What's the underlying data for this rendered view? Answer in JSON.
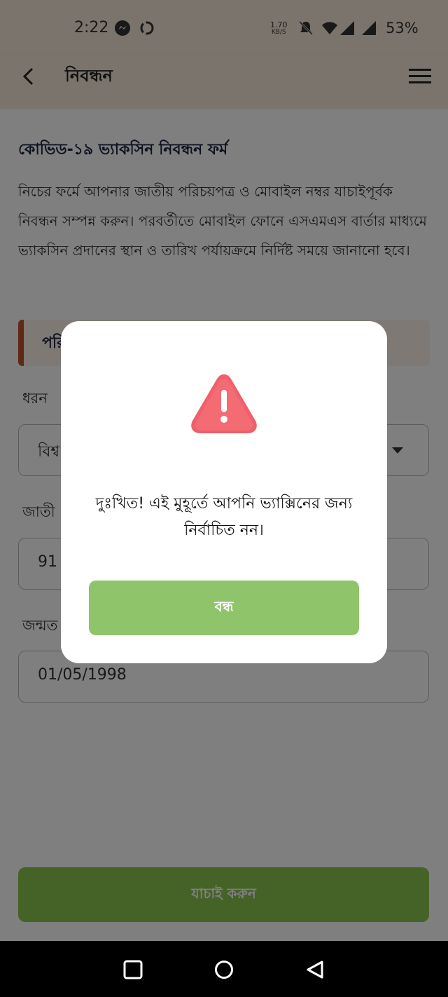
{
  "status_bar": {
    "time": "2:22",
    "speed_value": "1.70",
    "speed_unit": "KB/S",
    "battery": "53%"
  },
  "app_bar": {
    "title": "নিবন্ধন"
  },
  "page": {
    "form_title": "কোভিড-১৯ ভ্যাকসিন নিবন্ধন ফর্ম",
    "description": "নিচের ফর্মে আপনার জাতীয় পরিচয়পত্র ও মোবাইল নম্বর যাচাইপূর্বক নিবন্ধন সম্পন্ন করুন। পরবর্তীতে মোবাইল ফোনে এসএমএস বার্তার মাধ্যমে ভ্যাকসিন প্রদানের স্থান ও তারিখ পর্যায়ক্রমে নির্দিষ্ট সময়ে জানানো হবে।",
    "section_heading_partial": "পরি",
    "type_label_partial": "ধরন",
    "type_value_partial": "বিশ্ব",
    "nid_label_partial": "জাতী",
    "nid_value_partial": "91",
    "dob_label_partial": "জন্মত",
    "dob_value": "01/05/1998",
    "verify_button": "যাচাই করুন"
  },
  "dialog": {
    "icon": "warning-triangle-icon",
    "message": "দুঃখিত! এই মুহূর্তে আপনি ভ্যাক্সিনের জন্য নির্বাচিত নন।",
    "close_button": "বন্ধ"
  },
  "colors": {
    "header_bg": "#f5e9d8",
    "accent_green": "#8ac44f",
    "dialog_button_green": "#8fc46b",
    "warning_red": "#f0606a",
    "section_accent": "#c0522b"
  }
}
